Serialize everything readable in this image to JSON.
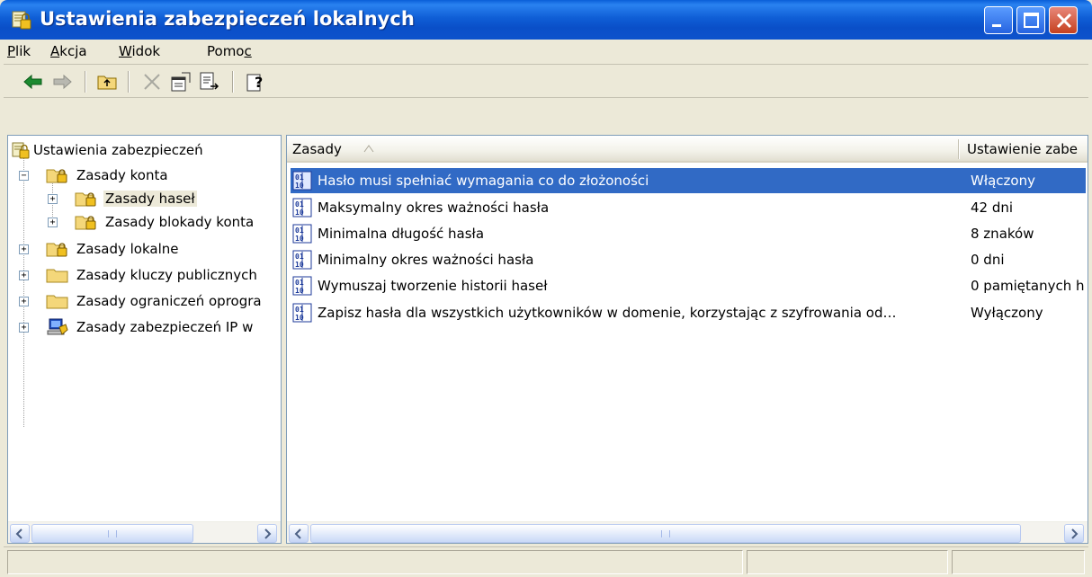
{
  "window": {
    "title": "Ustawienia zabezpieczeń lokalnych",
    "colors": {
      "titlebar": "#0a5fd8",
      "selection": "#316ac5",
      "close_button": "#c5401f"
    }
  },
  "menu": {
    "items": [
      {
        "label": "Plik",
        "accel": "P"
      },
      {
        "label": "Akcja",
        "accel": "A"
      },
      {
        "label": "Widok",
        "accel": "W"
      },
      {
        "label": "Pomoc",
        "accel": "c"
      }
    ]
  },
  "toolbar": {
    "buttons": [
      "back-arrow-icon",
      "forward-arrow-icon",
      "up-folder-icon",
      "delete-icon",
      "properties-icon",
      "export-list-icon",
      "help-icon"
    ]
  },
  "tree": {
    "root": {
      "label": "Ustawienia zabezpieczeń",
      "icon": "security-settings-icon"
    },
    "items": [
      {
        "label": "Zasady konta",
        "expander": "−",
        "icon": "folder-lock-icon"
      },
      {
        "label": "Zasady haseł",
        "expander": "+",
        "icon": "folder-lock-icon",
        "selected": true
      },
      {
        "label": "Zasady blokady konta",
        "expander": "+",
        "icon": "folder-lock-icon"
      },
      {
        "label": "Zasady lokalne",
        "expander": "+",
        "icon": "folder-lock-icon"
      },
      {
        "label": "Zasady kluczy publicznych",
        "expander": "+",
        "icon": "folder-icon"
      },
      {
        "label": "Zasady ograniczeń oprogra",
        "expander": "+",
        "icon": "folder-icon"
      },
      {
        "label": "Zasady zabezpieczeń IP w",
        "expander": "+",
        "icon": "ip-security-icon"
      }
    ]
  },
  "list": {
    "columns": [
      {
        "label": "Zasady",
        "sort": "ascending"
      },
      {
        "label": "Ustawienie zabe"
      }
    ],
    "rows": [
      {
        "policy": "Hasło musi spełniać wymagania co do złożoności",
        "setting": "Włączony",
        "selected": true
      },
      {
        "policy": "Maksymalny okres ważności hasła",
        "setting": "42 dni"
      },
      {
        "policy": "Minimalna długość hasła",
        "setting": "8 znaków"
      },
      {
        "policy": "Minimalny okres ważności hasła",
        "setting": "0 dni"
      },
      {
        "policy": "Wymuszaj tworzenie historii haseł",
        "setting": "0 pamiętanych h"
      },
      {
        "policy": "Zapisz hasła dla wszystkich użytkowników w domenie, korzystając z szyfrowania od…",
        "setting": "Wyłączony"
      }
    ]
  },
  "statusbar": {
    "text": ""
  }
}
